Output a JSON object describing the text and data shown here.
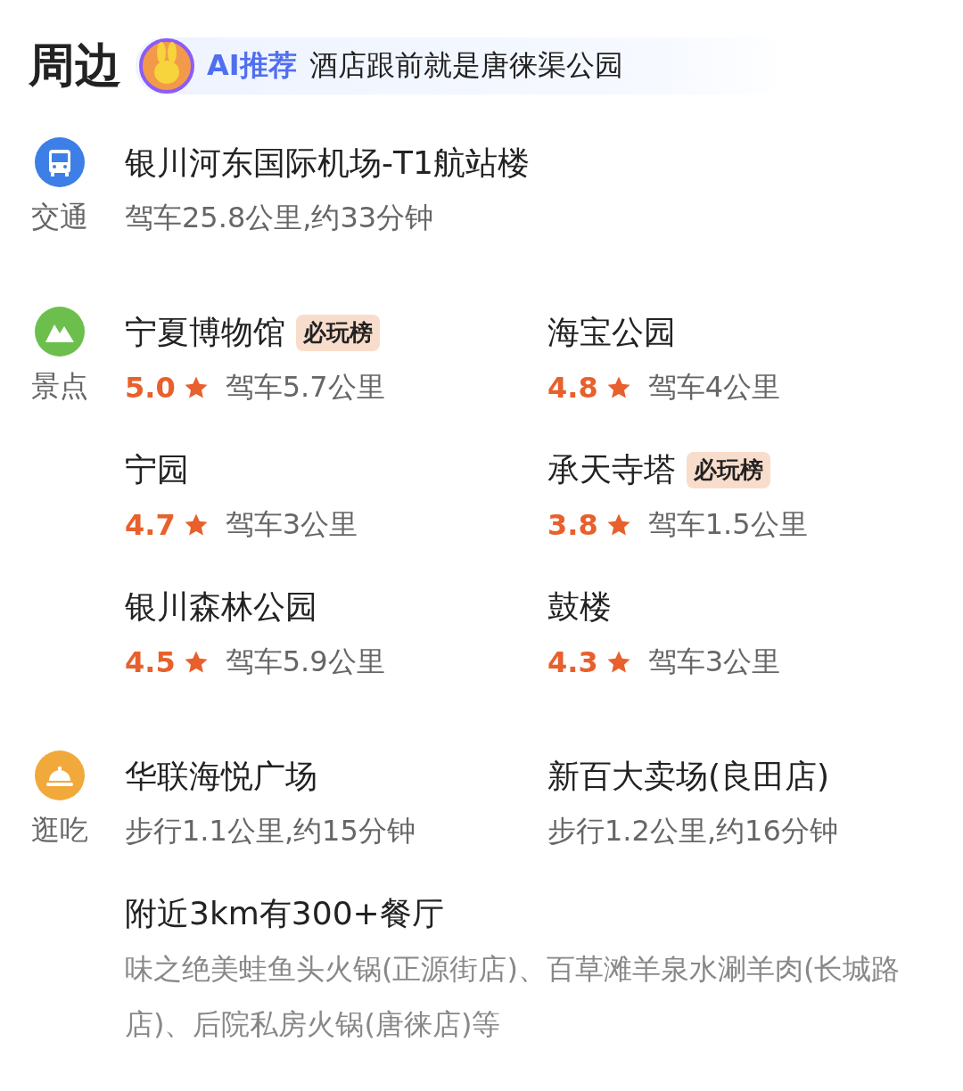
{
  "header": {
    "title": "周边",
    "ai_tag": "AI推荐",
    "ai_text": "酒店跟前就是唐徕渠公园"
  },
  "sections": [
    {
      "kind": "transport",
      "label": "交通",
      "items": [
        {
          "name": "银川河东国际机场-T1航站楼",
          "distance": "驾车25.8公里,约33分钟"
        }
      ]
    },
    {
      "kind": "sights",
      "label": "景点",
      "items": [
        {
          "name": "宁夏博物馆",
          "badge": "必玩榜",
          "rating": "5.0",
          "distance": "驾车5.7公里"
        },
        {
          "name": "海宝公园",
          "rating": "4.8",
          "distance": "驾车4公里"
        },
        {
          "name": "宁园",
          "rating": "4.7",
          "distance": "驾车3公里"
        },
        {
          "name": "承天寺塔",
          "badge": "必玩榜",
          "rating": "3.8",
          "distance": "驾车1.5公里"
        },
        {
          "name": "银川森林公园",
          "rating": "4.5",
          "distance": "驾车5.9公里"
        },
        {
          "name": "鼓楼",
          "rating": "4.3",
          "distance": "驾车3公里"
        }
      ]
    },
    {
      "kind": "food",
      "label": "逛吃",
      "items": [
        {
          "name": "华联海悦广场",
          "distance": "步行1.1公里,约15分钟"
        },
        {
          "name": "新百大卖场(良田店)",
          "distance": "步行1.2公里,约16分钟"
        }
      ],
      "summary": {
        "title": "附近3km有300+餐厅",
        "text": "味之绝美蛙鱼头火锅(正源街店)、百草滩羊泉水涮羊肉(长城路店)、后院私房火锅(唐徕店)等"
      }
    }
  ]
}
